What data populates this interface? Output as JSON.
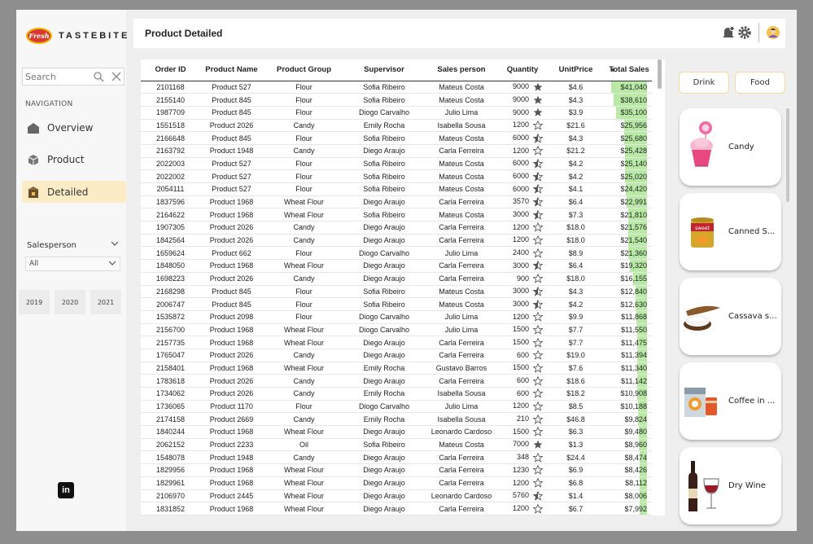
{
  "brand": {
    "name": "TASTEBITE",
    "badge": "Fresh"
  },
  "search": {
    "placeholder": "Search"
  },
  "nav": {
    "heading": "NAVIGATION",
    "items": [
      {
        "label": "Overview",
        "icon": "home-icon",
        "active": false
      },
      {
        "label": "Product",
        "icon": "boxes-icon",
        "active": false
      },
      {
        "label": "Detailed",
        "icon": "detail-box-icon",
        "active": true
      }
    ]
  },
  "filters": {
    "salesperson_label": "Salesperson",
    "salesperson_value": "All",
    "years": [
      "2019",
      "2020",
      "2021"
    ]
  },
  "header": {
    "title": "Product Detailed"
  },
  "table": {
    "columns": [
      "Order ID",
      "Product Name",
      "Product Group",
      "Supervisor",
      "Sales person",
      "Quantity",
      "UnitPrice",
      "Total Sales"
    ],
    "max_total": 41040,
    "rows": [
      [
        "2101168",
        "Product 527",
        "Flour",
        "Sofia Ribeiro",
        "Mateus Costa",
        "9000",
        "$4.6",
        "$41,040",
        "full"
      ],
      [
        "2155140",
        "Product 845",
        "Flour",
        "Sofia Ribeiro",
        "Mateus Costa",
        "9000",
        "$4.3",
        "$38,610",
        "full"
      ],
      [
        "1987709",
        "Product 845",
        "Flour",
        "Diogo Carvalho",
        "Julio Lima",
        "9000",
        "$3.9",
        "$35,100",
        "full"
      ],
      [
        "1551518",
        "Product 2026",
        "Candy",
        "Emily Rocha",
        "Isabella Sousa",
        "1200",
        "$21.6",
        "$25,956",
        "empty"
      ],
      [
        "2166648",
        "Product 845",
        "Flour",
        "Sofia Ribeiro",
        "Mateus Costa",
        "6000",
        "$4.3",
        "$25,680",
        "half"
      ],
      [
        "2163792",
        "Product 1948",
        "Candy",
        "Diego Araujo",
        "Carla Ferreira",
        "1200",
        "$21.2",
        "$25,428",
        "empty"
      ],
      [
        "2022003",
        "Product 527",
        "Flour",
        "Sofia Ribeiro",
        "Mateus Costa",
        "6000",
        "$4.2",
        "$25,140",
        "half"
      ],
      [
        "2022002",
        "Product 527",
        "Flour",
        "Sofia Ribeiro",
        "Mateus Costa",
        "6000",
        "$4.2",
        "$25,020",
        "half"
      ],
      [
        "2054111",
        "Product 527",
        "Flour",
        "Sofia Ribeiro",
        "Mateus Costa",
        "6000",
        "$4.1",
        "$24,420",
        "half"
      ],
      [
        "1837596",
        "Product 1968",
        "Wheat Flour",
        "Diego Araujo",
        "Carla Ferreira",
        "3570",
        "$6.4",
        "$22,991",
        "half"
      ],
      [
        "2164622",
        "Product 1968",
        "Wheat Flour",
        "Sofia Ribeiro",
        "Mateus Costa",
        "3000",
        "$7.3",
        "$21,810",
        "half"
      ],
      [
        "1907305",
        "Product 2026",
        "Candy",
        "Diego Araujo",
        "Carla Ferreira",
        "1200",
        "$18.0",
        "$21,576",
        "empty"
      ],
      [
        "1842564",
        "Product 2026",
        "Candy",
        "Diego Araujo",
        "Carla Ferreira",
        "1200",
        "$18.0",
        "$21,540",
        "empty"
      ],
      [
        "1659624",
        "Product 662",
        "Flour",
        "Diogo Carvalho",
        "Julio Lima",
        "2400",
        "$8.9",
        "$21,360",
        "empty"
      ],
      [
        "1848050",
        "Product 1968",
        "Wheat Flour",
        "Diego Araujo",
        "Carla Ferreira",
        "3000",
        "$6.4",
        "$19,320",
        "half"
      ],
      [
        "1698223",
        "Product 2026",
        "Candy",
        "Diego Araujo",
        "Carla Ferreira",
        "900",
        "$18.0",
        "$16,155",
        "empty"
      ],
      [
        "2168298",
        "Product 845",
        "Flour",
        "Sofia Ribeiro",
        "Mateus Costa",
        "3000",
        "$4.3",
        "$12,840",
        "half"
      ],
      [
        "2006747",
        "Product 845",
        "Flour",
        "Sofia Ribeiro",
        "Mateus Costa",
        "3000",
        "$4.2",
        "$12,630",
        "half"
      ],
      [
        "1535872",
        "Product 2098",
        "Flour",
        "Diogo Carvalho",
        "Julio Lima",
        "1200",
        "$9.9",
        "$11,868",
        "empty"
      ],
      [
        "2156700",
        "Product 1968",
        "Wheat Flour",
        "Diogo Carvalho",
        "Julio Lima",
        "1500",
        "$7.7",
        "$11,550",
        "empty"
      ],
      [
        "2157735",
        "Product 1968",
        "Wheat Flour",
        "Diego Araujo",
        "Carla Ferreira",
        "1500",
        "$7.7",
        "$11,475",
        "empty"
      ],
      [
        "1765047",
        "Product 2026",
        "Candy",
        "Diego Araujo",
        "Carla Ferreira",
        "600",
        "$19.0",
        "$11,394",
        "empty"
      ],
      [
        "2158401",
        "Product 1968",
        "Wheat Flour",
        "Emily Rocha",
        "Gustavo Barros",
        "1500",
        "$7.6",
        "$11,340",
        "empty"
      ],
      [
        "1783618",
        "Product 2026",
        "Candy",
        "Diego Araujo",
        "Carla Ferreira",
        "600",
        "$18.6",
        "$11,142",
        "empty"
      ],
      [
        "1734062",
        "Product 2026",
        "Candy",
        "Emily Rocha",
        "Isabella Sousa",
        "600",
        "$18.2",
        "$10,908",
        "empty"
      ],
      [
        "1736065",
        "Product 1170",
        "Flour",
        "Diogo Carvalho",
        "Julio Lima",
        "1200",
        "$8.5",
        "$10,188",
        "empty"
      ],
      [
        "2174158",
        "Product 2669",
        "Candy",
        "Emily Rocha",
        "Isabella Sousa",
        "210",
        "$46.8",
        "$9,824",
        "empty"
      ],
      [
        "1840244",
        "Product 1968",
        "Wheat Flour",
        "Diego Araujo",
        "Leonardo Cardoso",
        "1500",
        "$6.3",
        "$9,480",
        "empty"
      ],
      [
        "2062152",
        "Product 2233",
        "Oil",
        "Sofia Ribeiro",
        "Mateus Costa",
        "7000",
        "$1.3",
        "$8,960",
        "full"
      ],
      [
        "1548078",
        "Product 1948",
        "Candy",
        "Diego Araujo",
        "Carla Ferreira",
        "348",
        "$24.4",
        "$8,474",
        "empty"
      ],
      [
        "1829956",
        "Product 1968",
        "Wheat Flour",
        "Diego Araujo",
        "Carla Ferreira",
        "1230",
        "$6.9",
        "$8,426",
        "empty"
      ],
      [
        "1829961",
        "Product 1968",
        "Wheat Flour",
        "Diego Araujo",
        "Carla Ferreira",
        "1200",
        "$6.8",
        "$8,112",
        "empty"
      ],
      [
        "2106970",
        "Product 2445",
        "Wheat Flour",
        "Diego Araujo",
        "Leonardo Cardoso",
        "5760",
        "$1.4",
        "$8,006",
        "half"
      ],
      [
        "1831852",
        "Product 1968",
        "Wheat Flour",
        "Diego Araujo",
        "Carla Ferreira",
        "1200",
        "$6.7",
        "$7,992",
        "empty"
      ]
    ]
  },
  "categories": [
    "Drink",
    "Food"
  ],
  "products": [
    {
      "label": "Candy",
      "icon": "cupcake-icon"
    },
    {
      "label": "Canned S...",
      "icon": "canned-food-icon"
    },
    {
      "label": "Cassava s...",
      "icon": "cassava-icon"
    },
    {
      "label": "Coffee in ...",
      "icon": "coffee-icon"
    },
    {
      "label": "Dry Wine",
      "icon": "wine-icon"
    }
  ],
  "colors": {
    "accent": "#fbecc6",
    "bar": "#b8eaa6",
    "star": "#555555"
  }
}
